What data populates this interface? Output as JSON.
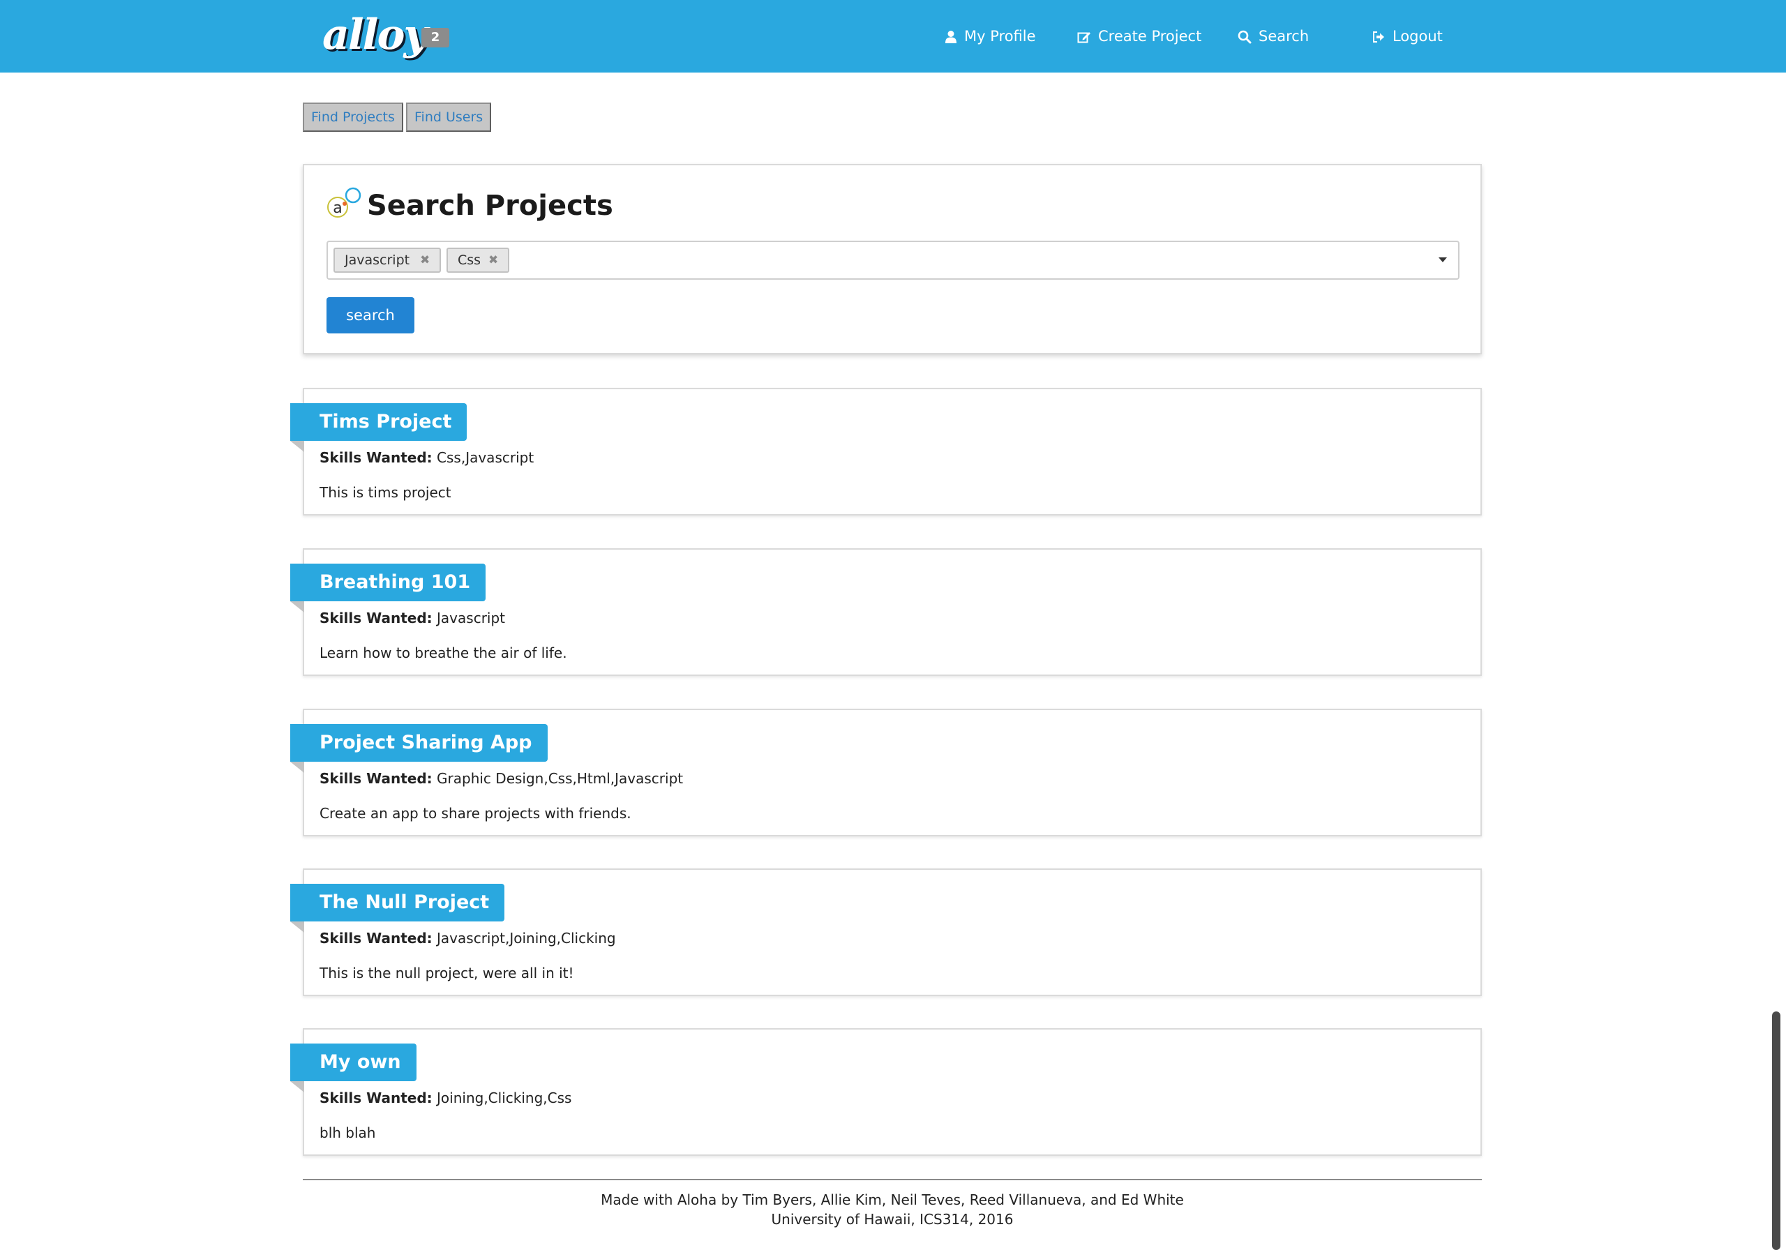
{
  "navbar": {
    "logo_text": "alloy",
    "notification_count": "2",
    "items": [
      {
        "label": "My Profile",
        "icon": "user-icon"
      },
      {
        "label": "Create Project",
        "icon": "edit-icon"
      },
      {
        "label": "Search",
        "icon": "search-icon"
      },
      {
        "label": "Logout",
        "icon": "logout-icon"
      }
    ]
  },
  "tabs": [
    {
      "label": "Find Projects"
    },
    {
      "label": "Find Users"
    }
  ],
  "search_panel": {
    "title": "Search Projects",
    "selected_tags": [
      "Javascript",
      "Css"
    ],
    "remove_glyph": "✖",
    "button_label": "search"
  },
  "results": {
    "skills_label": "Skills Wanted:",
    "items": [
      {
        "title": "Tims Project",
        "skills": "Css,Javascript",
        "description": "This is tims project"
      },
      {
        "title": "Breathing 101",
        "skills": "Javascript",
        "description": "Learn how to breathe the air of life."
      },
      {
        "title": "Project Sharing App",
        "skills": "Graphic Design,Css,Html,Javascript",
        "description": "Create an app to share projects with friends."
      },
      {
        "title": "The Null Project",
        "skills": "Javascript,Joining,Clicking",
        "description": "This is the null project, were all in it!"
      },
      {
        "title": "My own",
        "skills": "Joining,Clicking,Css",
        "description": "blh blah"
      }
    ]
  },
  "footer": {
    "line1": "Made with Aloha by Tim Byers, Allie Kim, Neil Teves, Reed Villanueva, and Ed White",
    "line2": "University of Hawaii, ICS314, 2016"
  },
  "colors": {
    "brand": "#2aa8df",
    "button": "#2284d3",
    "tab_background": "#c6c6c6",
    "link": "#2f7dc0"
  }
}
